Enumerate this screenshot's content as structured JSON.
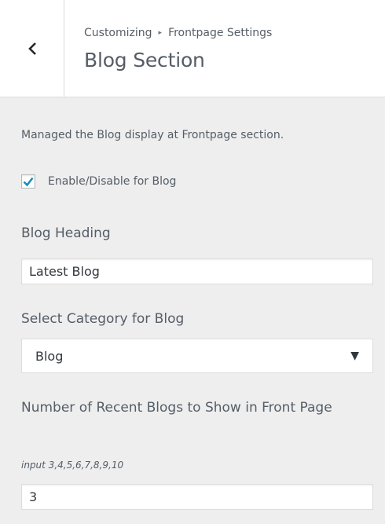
{
  "header": {
    "breadcrumb_parent": "Customizing",
    "breadcrumb_child": "Frontpage Settings",
    "title": "Blog Section",
    "back_icon": "chevron-left-icon"
  },
  "section": {
    "description": "Managed the Blog display at Frontpage section.",
    "enable_checkbox": {
      "label": "Enable/Disable for Blog",
      "checked": true
    },
    "blog_heading": {
      "label": "Blog Heading",
      "value": "Latest Blog"
    },
    "category": {
      "label": "Select Category for Blog",
      "selected": "Blog",
      "arrow": "▼"
    },
    "recent_count": {
      "label": "Number of Recent Blogs to Show in Front Page",
      "hint": "input 3,4,5,6,7,8,9,10",
      "value": "3"
    }
  }
}
